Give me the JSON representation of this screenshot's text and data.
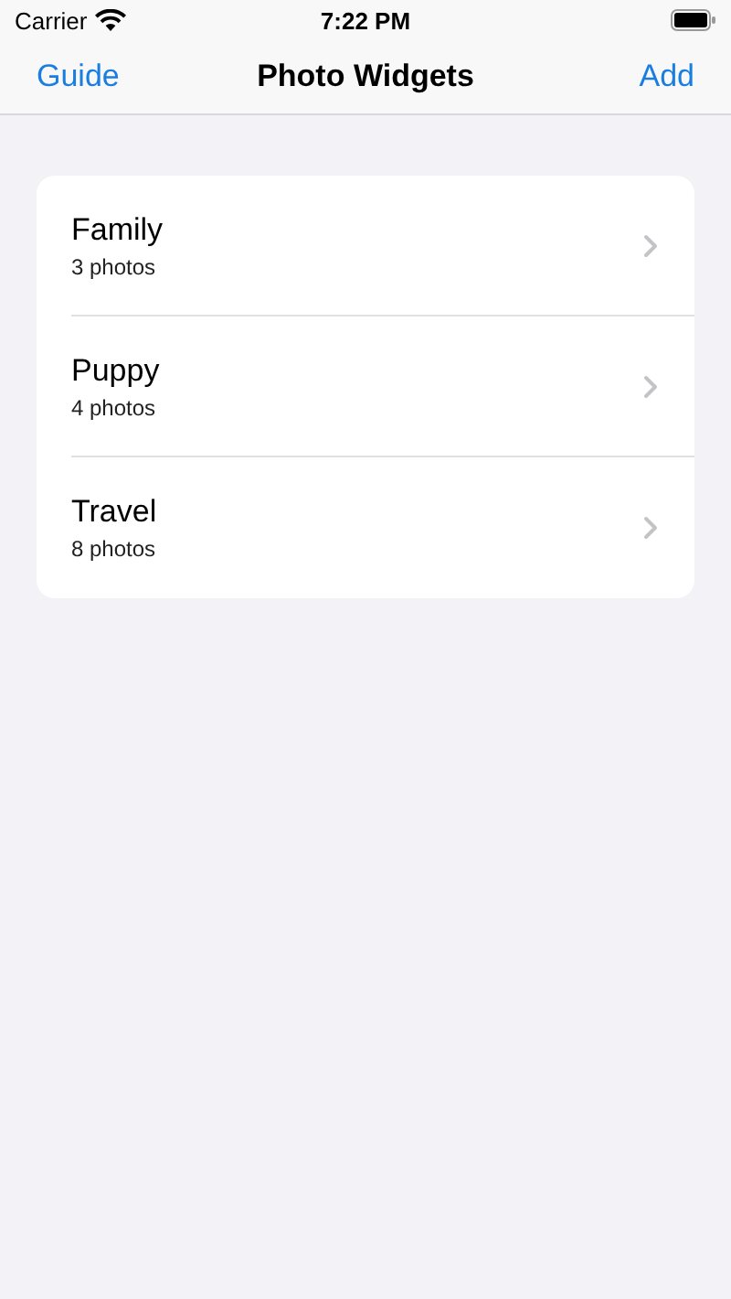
{
  "status_bar": {
    "carrier": "Carrier",
    "time": "7:22 PM"
  },
  "nav_bar": {
    "left_button": "Guide",
    "title": "Photo Widgets",
    "right_button": "Add"
  },
  "albums": [
    {
      "name": "Family",
      "count": "3 photos"
    },
    {
      "name": "Puppy",
      "count": "4 photos"
    },
    {
      "name": "Travel",
      "count": "8 photos"
    }
  ]
}
